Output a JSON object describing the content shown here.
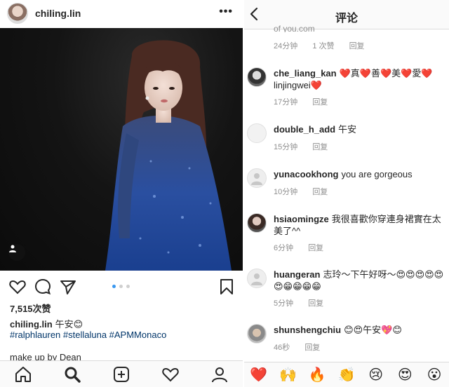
{
  "left": {
    "username": "chiling.lin",
    "likes": "7,515次赞",
    "caption_user": "chiling.lin",
    "caption_text": "午安😊",
    "hashtags": "#ralphlauren #stellaluna #APMMonaco",
    "more_text": "make up by Dean"
  },
  "right": {
    "title": "评论",
    "partial_text": "of you.com",
    "partial_meta": {
      "time": "24分钟",
      "likes": "1 次赞",
      "reply": "回复"
    },
    "comments": [
      {
        "user": "che_liang_kan",
        "text": "❤️真❤️善❤️美❤️愛❤️linjingwei❤️",
        "time": "17分钟",
        "reply": "回复"
      },
      {
        "user": "double_h_add",
        "text": "午安",
        "time": "15分钟",
        "reply": "回复"
      },
      {
        "user": "yunacookhong",
        "text": "you are gorgeous",
        "time": "10分钟",
        "reply": "回复"
      },
      {
        "user": "hsiaomingze",
        "text": "我很喜歡你穿連身裙實在太美了^^",
        "time": "6分钟",
        "reply": "回复"
      },
      {
        "user": "huangeran",
        "text": "志玲～下午好呀～😍😍😍😍😍😍😁😁😁😁",
        "time": "5分钟",
        "reply": "回复"
      },
      {
        "user": "shunshengchiu",
        "text": "😊😍午安💖😊",
        "time": "46秒",
        "reply": "回复"
      }
    ],
    "emoji_bar": [
      "❤️",
      "🙌",
      "🔥",
      "👏",
      "😢",
      "😍",
      "😮"
    ]
  }
}
